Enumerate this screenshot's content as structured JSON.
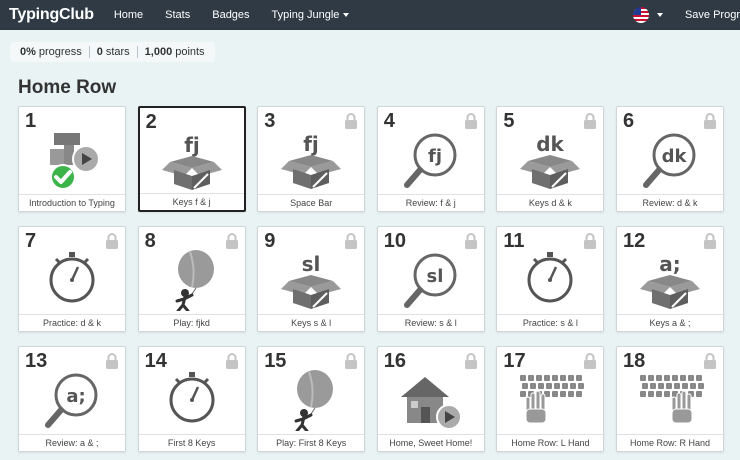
{
  "topbar": {
    "brand": "TypingClub",
    "nav": [
      "Home",
      "Stats",
      "Badges",
      "Typing Jungle"
    ],
    "save_label": "Save Progr"
  },
  "stats": {
    "progress_value": "0%",
    "progress_label": "progress",
    "stars_value": "0",
    "stars_label": "stars",
    "points_value": "1,000",
    "points_label": "points"
  },
  "section": {
    "title": "Home Row"
  },
  "lessons": [
    {
      "num": "1",
      "label": "Introduction to Typing",
      "icon": "intro-video",
      "locked": false,
      "completed": true,
      "selected": false,
      "glyph": ""
    },
    {
      "num": "2",
      "label": "Keys f & j",
      "icon": "box",
      "locked": false,
      "completed": false,
      "selected": true,
      "glyph": "fj"
    },
    {
      "num": "3",
      "label": "Space Bar",
      "icon": "box",
      "locked": true,
      "completed": false,
      "selected": false,
      "glyph": "fj"
    },
    {
      "num": "4",
      "label": "Review: f & j",
      "icon": "magnifier",
      "locked": true,
      "completed": false,
      "selected": false,
      "glyph": "fj"
    },
    {
      "num": "5",
      "label": "Keys d & k",
      "icon": "box",
      "locked": true,
      "completed": false,
      "selected": false,
      "glyph": "dk"
    },
    {
      "num": "6",
      "label": "Review: d & k",
      "icon": "magnifier",
      "locked": true,
      "completed": false,
      "selected": false,
      "glyph": "dk"
    },
    {
      "num": "7",
      "label": "Practice: d & k",
      "icon": "stopwatch",
      "locked": true,
      "completed": false,
      "selected": false,
      "glyph": ""
    },
    {
      "num": "8",
      "label": "Play: fjkd",
      "icon": "balloon",
      "locked": true,
      "completed": false,
      "selected": false,
      "glyph": ""
    },
    {
      "num": "9",
      "label": "Keys s & l",
      "icon": "box",
      "locked": true,
      "completed": false,
      "selected": false,
      "glyph": "sl"
    },
    {
      "num": "10",
      "label": "Review: s & l",
      "icon": "magnifier",
      "locked": true,
      "completed": false,
      "selected": false,
      "glyph": "sl"
    },
    {
      "num": "11",
      "label": "Practice: s & l",
      "icon": "stopwatch",
      "locked": true,
      "completed": false,
      "selected": false,
      "glyph": ""
    },
    {
      "num": "12",
      "label": "Keys a & ;",
      "icon": "box",
      "locked": true,
      "completed": false,
      "selected": false,
      "glyph": "a;"
    },
    {
      "num": "13",
      "label": "Review: a & ;",
      "icon": "magnifier",
      "locked": true,
      "completed": false,
      "selected": false,
      "glyph": "a;"
    },
    {
      "num": "14",
      "label": "First 8 Keys",
      "icon": "stopwatch",
      "locked": true,
      "completed": false,
      "selected": false,
      "glyph": ""
    },
    {
      "num": "15",
      "label": "Play: First 8 Keys",
      "icon": "balloon",
      "locked": true,
      "completed": false,
      "selected": false,
      "glyph": ""
    },
    {
      "num": "16",
      "label": "Home, Sweet Home!",
      "icon": "house-video",
      "locked": true,
      "completed": false,
      "selected": false,
      "glyph": ""
    },
    {
      "num": "17",
      "label": "Home Row: L Hand",
      "icon": "keyboard-left-hand",
      "locked": true,
      "completed": false,
      "selected": false,
      "glyph": ""
    },
    {
      "num": "18",
      "label": "Home Row: R Hand",
      "icon": "keyboard-right-hand",
      "locked": true,
      "completed": false,
      "selected": false,
      "glyph": ""
    }
  ],
  "colors": {
    "topbar": "#2f3a45",
    "check": "#3bb54a",
    "icon_gray": "#777777"
  }
}
